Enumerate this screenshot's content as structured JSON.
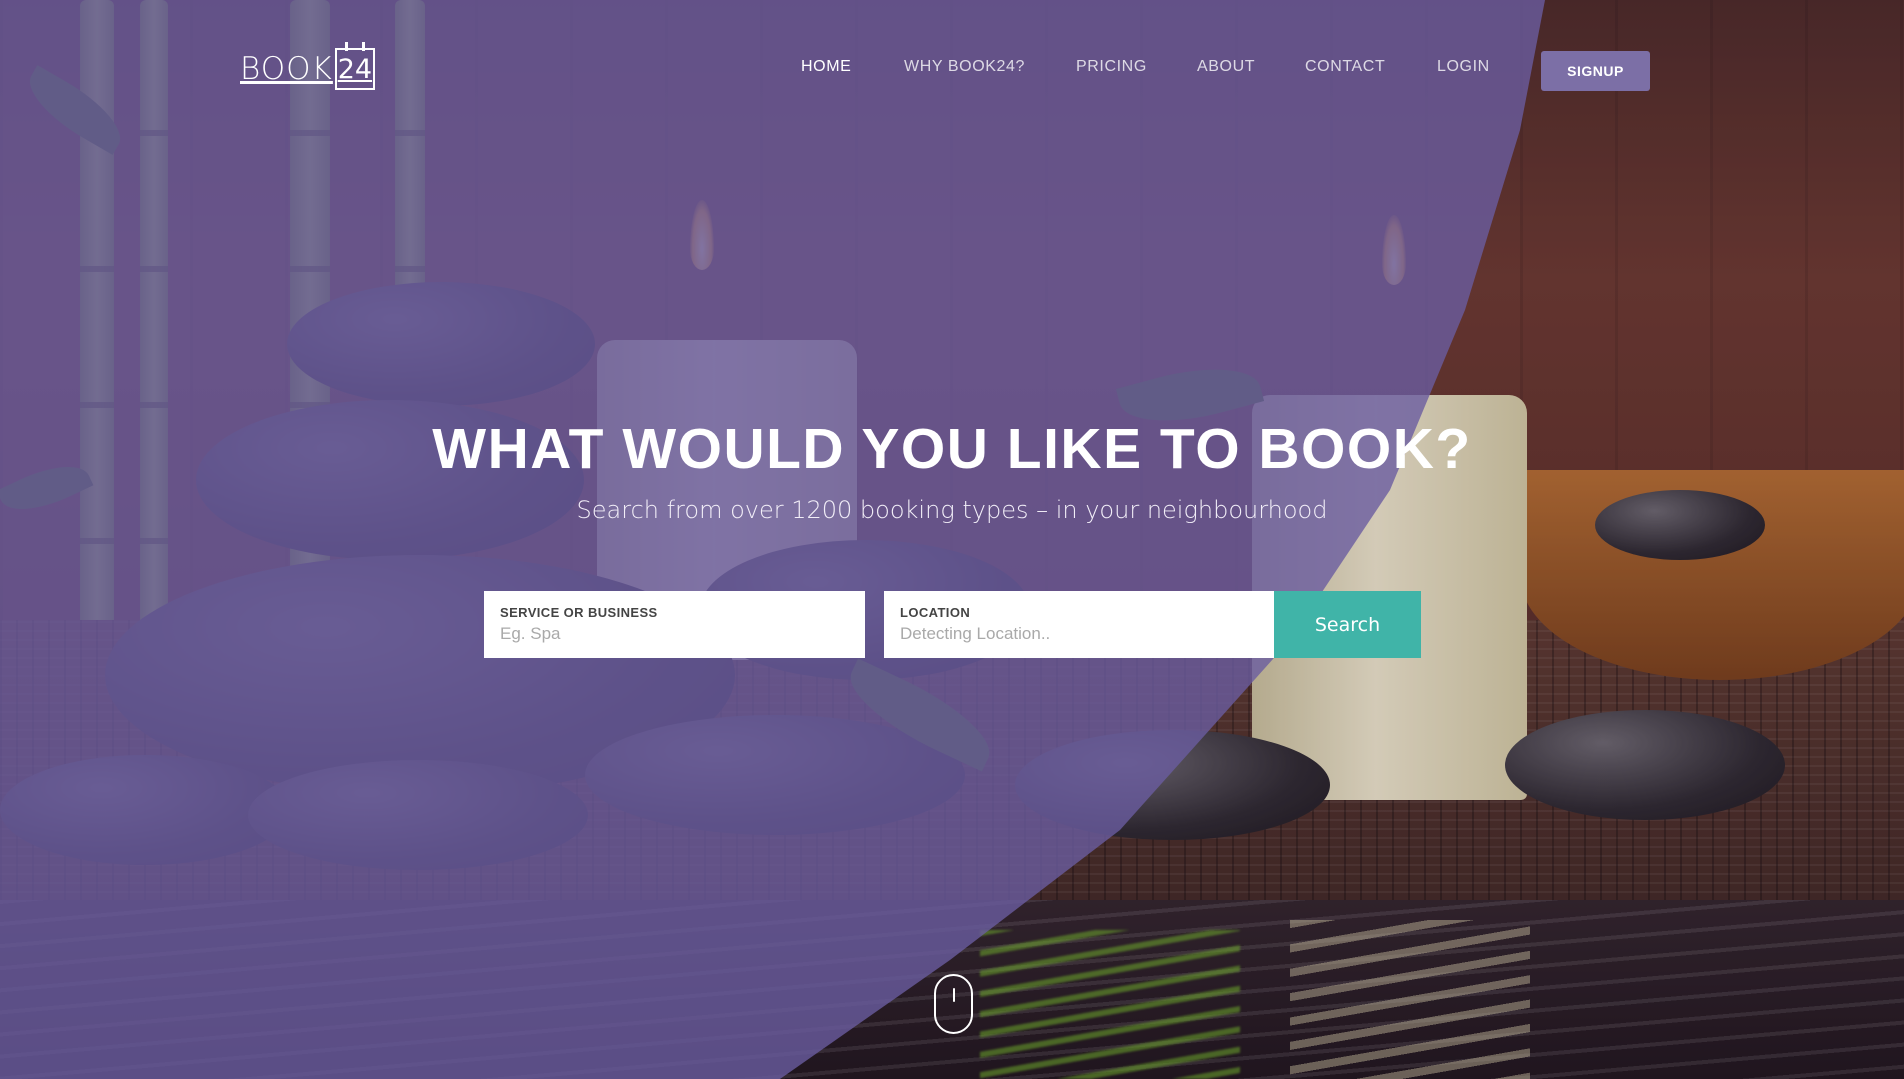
{
  "brand": {
    "logo_text": "BOOK",
    "logo_number": "24"
  },
  "nav": {
    "items": [
      {
        "label": "HOME",
        "active": true
      },
      {
        "label": "WHY BOOK24?",
        "active": false
      },
      {
        "label": "PRICING",
        "active": false
      },
      {
        "label": "ABOUT",
        "active": false
      },
      {
        "label": "CONTACT",
        "active": false
      },
      {
        "label": "LOGIN",
        "active": false
      }
    ],
    "signup_label": "SIGNUP"
  },
  "hero": {
    "title": "WHAT WOULD YOU LIKE TO BOOK?",
    "subtitle": "Search from over 1200 booking types – in your neighbourhood"
  },
  "search": {
    "service_label": "SERVICE OR BUSINESS",
    "service_placeholder": "Eg. Spa",
    "location_label": "LOCATION",
    "location_placeholder": "Detecting Location..",
    "button_label": "Search"
  },
  "colors": {
    "overlay_purple": "#6a5ca0",
    "signup_bg": "#7c6fa6",
    "search_button": "#40b4a8"
  },
  "icons": {
    "scroll": "mouse-scroll-icon"
  }
}
